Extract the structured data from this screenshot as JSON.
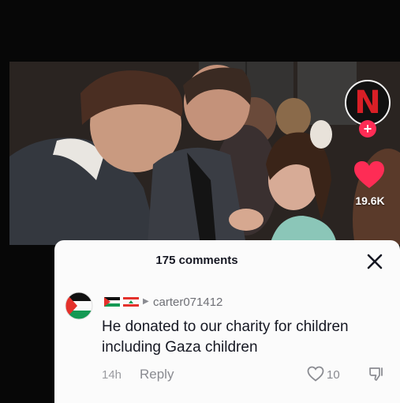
{
  "video": {
    "creator_logo": "N",
    "follow_label": "+",
    "like_count": "19.6K"
  },
  "comments": {
    "title": "175 comments",
    "close_icon": "close-icon",
    "items": [
      {
        "username": "carter071412",
        "flags": [
          "palestine-flag",
          "lebanon-flag"
        ],
        "text": "He donated to our charity for children including Gaza children",
        "time": "14h",
        "reply_label": "Reply",
        "likes": "10"
      }
    ]
  },
  "colors": {
    "accent": "#fe2c55",
    "brand_red": "#d81f26",
    "sheet_bg": "#fbfbfb",
    "text_primary": "#161823",
    "text_secondary": "#8a8b91"
  }
}
